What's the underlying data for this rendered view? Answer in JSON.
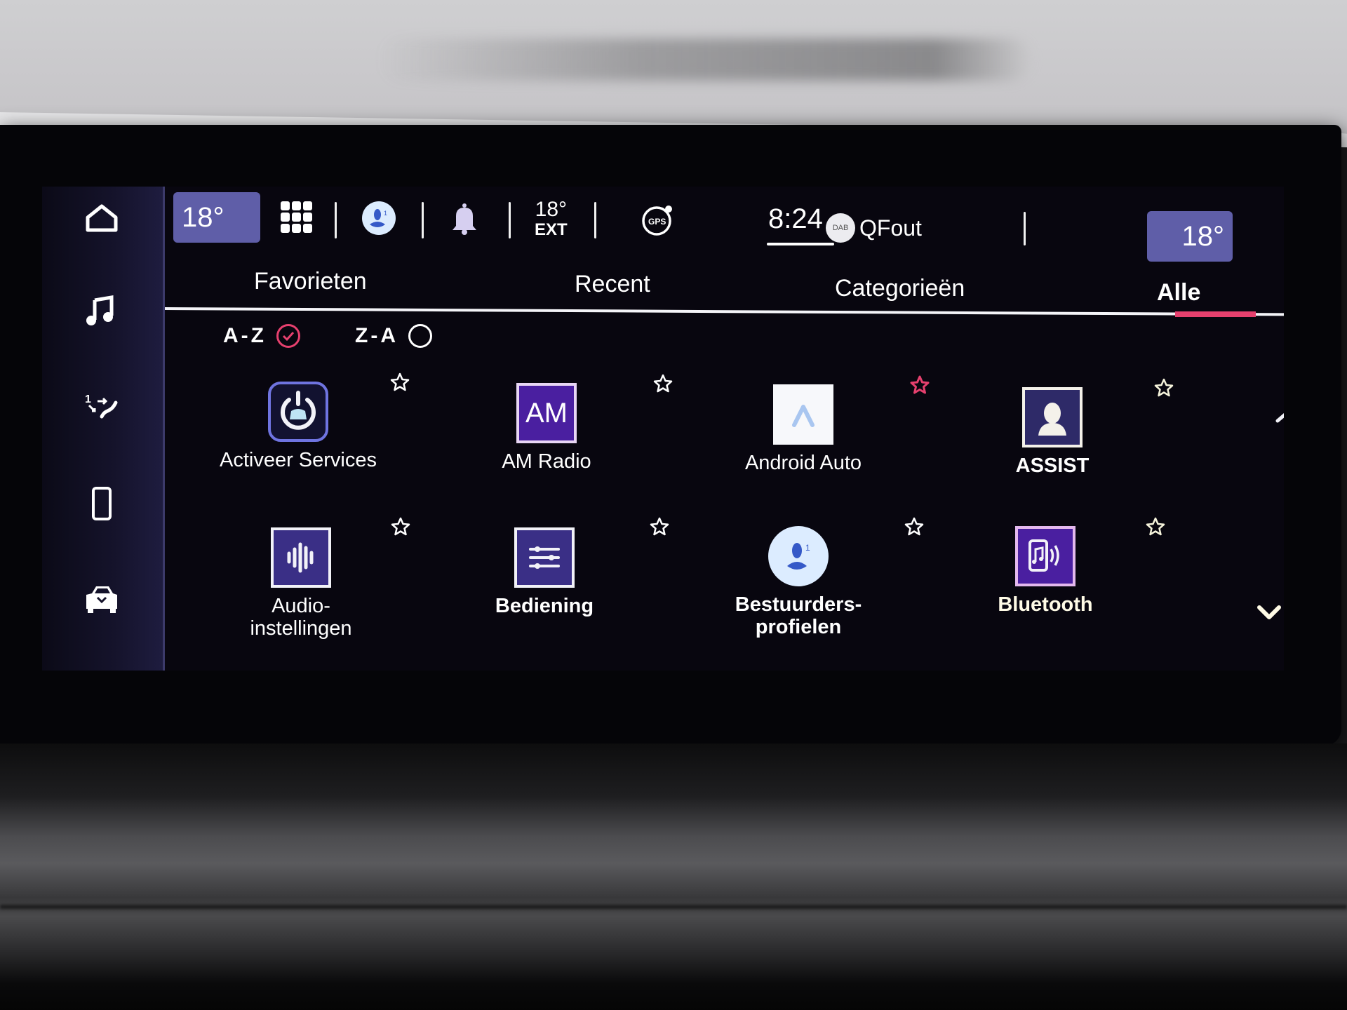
{
  "side_nav": {
    "items": [
      {
        "name": "home",
        "icon": "home-icon"
      },
      {
        "name": "media",
        "icon": "music-note-icon"
      },
      {
        "name": "navigation",
        "icon": "route-icon"
      },
      {
        "name": "phone",
        "icon": "phone-icon"
      },
      {
        "name": "vehicle",
        "icon": "car-icon"
      }
    ]
  },
  "status_bar": {
    "driver_temp": "18°",
    "passenger_temp": "18°",
    "apps_icon": "grid-icon",
    "profile_icon": "driver-profile-icon",
    "profile_number": "1",
    "notifications_icon": "bell-icon",
    "exterior_temp": "18°",
    "exterior_label": "EXT",
    "gps_label": "GPS",
    "clock": "8:24",
    "radio_band": "DAB",
    "radio_station": "QFout"
  },
  "tabs": [
    {
      "label": "Favorieten",
      "active": false
    },
    {
      "label": "Recent",
      "active": false
    },
    {
      "label": "Categorieën",
      "active": false
    },
    {
      "label": "Alle",
      "active": true
    }
  ],
  "sort": {
    "options": [
      {
        "label": "A-Z",
        "selected": true
      },
      {
        "label": "Z-A",
        "selected": false
      }
    ]
  },
  "apps": [
    {
      "label": "Activeer Services",
      "icon": "power-car-icon",
      "favorite": false
    },
    {
      "label": "AM Radio",
      "icon": "am-radio-icon",
      "icon_text": "AM",
      "favorite": false
    },
    {
      "label": "Android Auto",
      "icon": "android-auto-icon",
      "favorite": true
    },
    {
      "label": "ASSIST",
      "icon": "assist-agent-icon",
      "favorite": false
    },
    {
      "label": "Audio-\ninstellingen",
      "icon": "audio-waveform-icon",
      "favorite": false
    },
    {
      "label": "Bediening",
      "icon": "sliders-icon",
      "favorite": false
    },
    {
      "label": "Bestuurders-\nprofielen",
      "icon": "driver-profile-icon",
      "icon_text": "1",
      "favorite": false
    },
    {
      "label": "Bluetooth",
      "icon": "bluetooth-audio-icon",
      "favorite": false
    }
  ],
  "scroll": {
    "up_icon": "chevron-up-icon",
    "down_icon": "chevron-down-icon",
    "position": 0
  },
  "colors": {
    "accent": "#e6406e",
    "temp_pill": "#5f5ea8",
    "app_tile": "#3a2f86",
    "am_tile": "#4a1fa0",
    "profile_circle": "#dcecff",
    "profile_figure": "#3559c8"
  }
}
